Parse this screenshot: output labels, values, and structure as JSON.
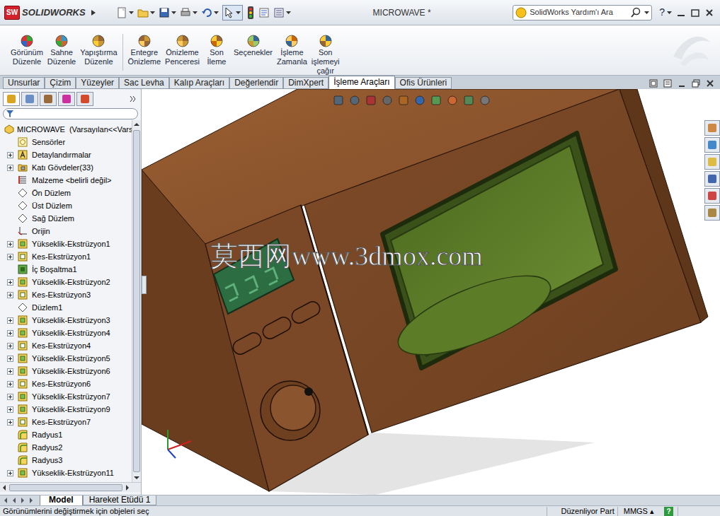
{
  "app": {
    "logo_mark": "SW",
    "logo": "SOLIDWORKS",
    "title": "MICROWAVE *",
    "help": "?"
  },
  "search": {
    "placeholder": "SolidWorks Yardım'ı Ara"
  },
  "ribbon": [
    {
      "lines": [
        "Görünüm",
        "Düzenle"
      ],
      "group": 1
    },
    {
      "lines": [
        "Sahne",
        "Düzenle"
      ],
      "group": 1
    },
    {
      "lines": [
        "Yapıştırma",
        "Düzenle"
      ],
      "group": 1
    },
    {
      "lines": [
        "Entegre",
        "Önizleme"
      ],
      "group": 2
    },
    {
      "lines": [
        "Önizleme",
        "Penceresi"
      ],
      "group": 2
    },
    {
      "lines": [
        "Son",
        "İleme"
      ],
      "group": 2
    },
    {
      "lines": [
        "Seçenekler"
      ],
      "group": 2
    },
    {
      "lines": [
        "İşleme",
        "Zamanla"
      ],
      "group": 2
    },
    {
      "lines": [
        "Son",
        "işlemeyi",
        "çağır"
      ],
      "group": 2
    }
  ],
  "tabs": [
    {
      "label": "Unsurlar",
      "selected": false
    },
    {
      "label": "Çizim",
      "selected": false
    },
    {
      "label": "Yüzeyler",
      "selected": false
    },
    {
      "label": "Sac Levha",
      "selected": false
    },
    {
      "label": "Kalıp Araçları",
      "selected": false
    },
    {
      "label": "Değerlendir",
      "selected": false
    },
    {
      "label": "DimXpert",
      "selected": false
    },
    {
      "label": "İşleme Araçları",
      "selected": true
    },
    {
      "label": "Ofis Ürünleri",
      "selected": false
    }
  ],
  "tree": {
    "root": "MICROWAVE  (Varsayılan<<Vars",
    "items": [
      {
        "label": "Sensörler",
        "kind": "sensor",
        "expandable": false
      },
      {
        "label": "Detaylandırmalar",
        "kind": "annotation",
        "expandable": true
      },
      {
        "label": "Katı Gövdeler(33)",
        "kind": "solids",
        "expandable": true
      },
      {
        "label": "Malzeme <belirli değil>",
        "kind": "material",
        "expandable": false
      },
      {
        "label": "Ön Düzlem",
        "kind": "plane",
        "expandable": false
      },
      {
        "label": "Üst Düzlem",
        "kind": "plane",
        "expandable": false
      },
      {
        "label": "Sağ Düzlem",
        "kind": "plane",
        "expandable": false
      },
      {
        "label": "Orijin",
        "kind": "origin",
        "expandable": false
      },
      {
        "label": "Yükseklik-Ekstrüzyon1",
        "kind": "extrude",
        "expandable": true
      },
      {
        "label": "Kes-Ekstrüzyon1",
        "kind": "cut",
        "expandable": true
      },
      {
        "label": "İç Boşaltma1",
        "kind": "shell",
        "expandable": false
      },
      {
        "label": "Yükseklik-Ekstrüzyon2",
        "kind": "extrude",
        "expandable": true
      },
      {
        "label": "Kes-Ekstrüzyon3",
        "kind": "cut",
        "expandable": true
      },
      {
        "label": "Düzlem1",
        "kind": "plane",
        "expandable": false
      },
      {
        "label": "Yükseklik-Ekstrüzyon3",
        "kind": "extrude",
        "expandable": true
      },
      {
        "label": "Yükseklik-Ekstrüzyon4",
        "kind": "extrude",
        "expandable": true
      },
      {
        "label": "Kes-Ekstrüzyon4",
        "kind": "cut",
        "expandable": true
      },
      {
        "label": "Yükseklik-Ekstrüzyon5",
        "kind": "extrude",
        "expandable": true
      },
      {
        "label": "Yükseklik-Ekstrüzyon6",
        "kind": "extrude",
        "expandable": true
      },
      {
        "label": "Kes-Ekstrüzyon6",
        "kind": "cut",
        "expandable": true
      },
      {
        "label": "Yükseklik-Ekstrüzyon7",
        "kind": "extrude",
        "expandable": true
      },
      {
        "label": "Yükseklik-Ekstrüzyon9",
        "kind": "extrude",
        "expandable": true
      },
      {
        "label": "Kes-Ekstrüzyon7",
        "kind": "cut",
        "expandable": true
      },
      {
        "label": "Radyus1",
        "kind": "fillet",
        "expandable": false
      },
      {
        "label": "Radyus2",
        "kind": "fillet",
        "expandable": false
      },
      {
        "label": "Radyus3",
        "kind": "fillet",
        "expandable": false
      },
      {
        "label": "Yükseklik-Ekstrüzyon11",
        "kind": "extrude",
        "expandable": true
      }
    ]
  },
  "watermark": "莫西网www.3dmox.com",
  "bottom_tabs": [
    {
      "label": "Model",
      "selected": true
    },
    {
      "label": "Hareket Etüdü 1",
      "selected": false
    }
  ],
  "status_bar": {
    "message": "Görünümlerini değiştirmek için objeleri seç",
    "mode": "Düzenliyor Part",
    "units": "MMGS ▴",
    "help": "?"
  }
}
